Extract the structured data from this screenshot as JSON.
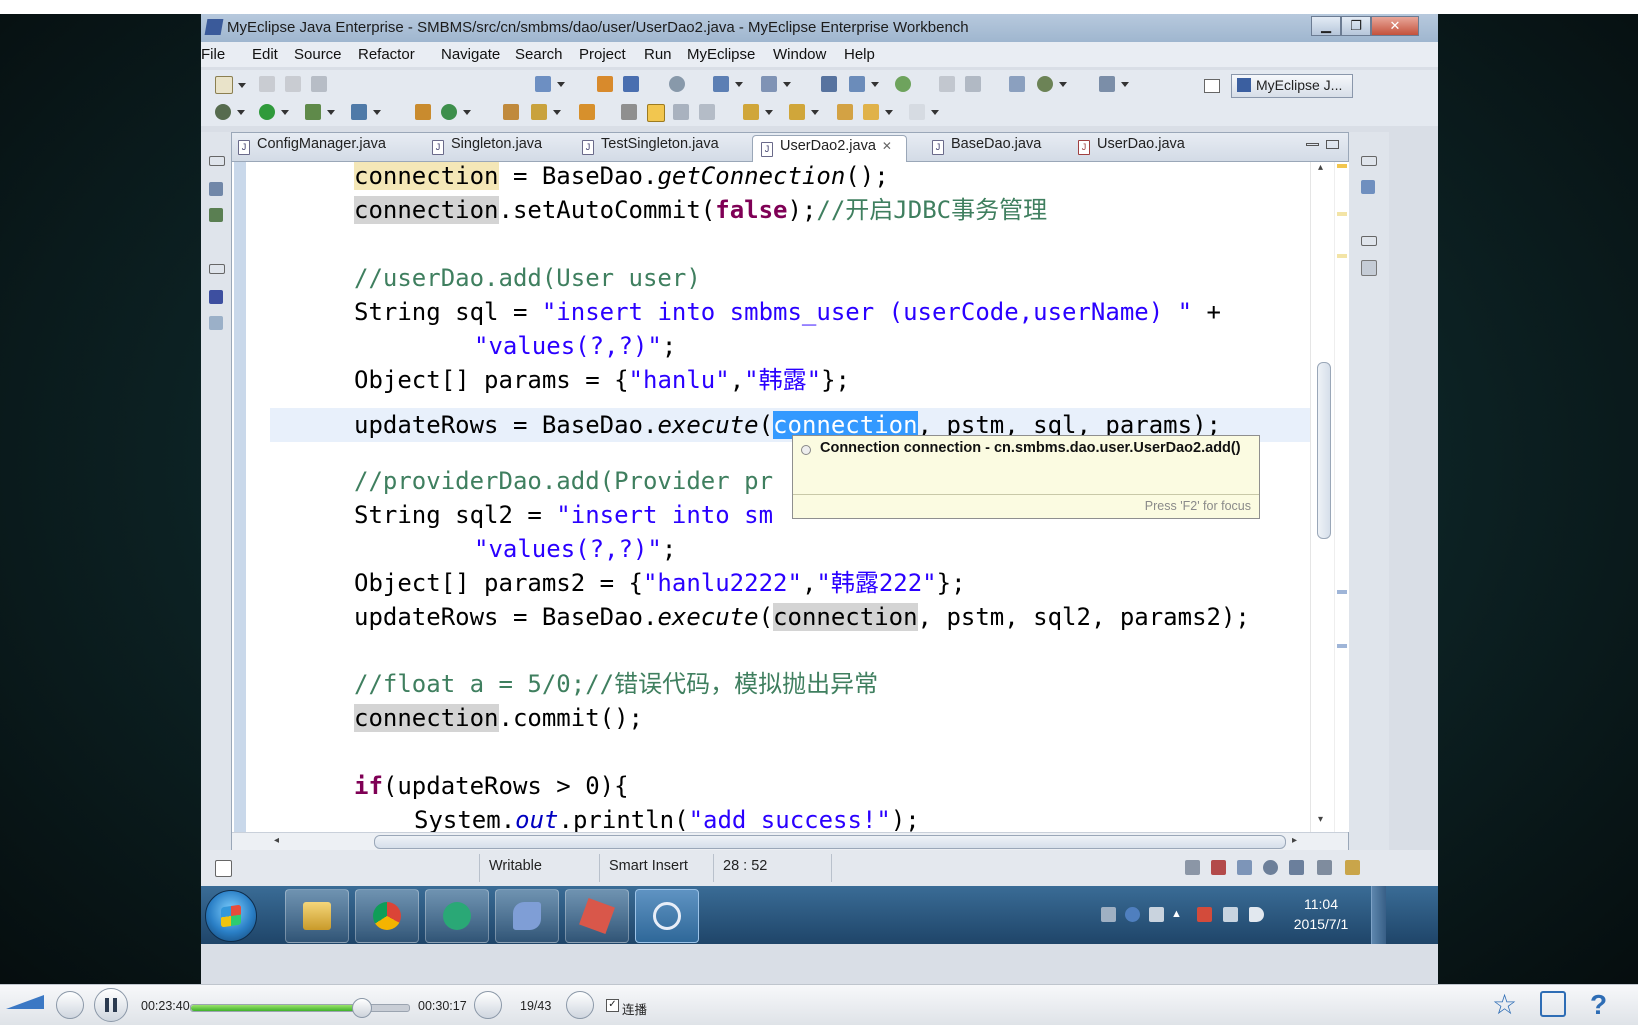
{
  "window": {
    "title": "MyEclipse Java Enterprise - SMBMS/src/cn/smbms/dao/user/UserDao2.java - MyEclipse Enterprise Workbench",
    "minimize": "▁",
    "maximize": "❐",
    "close": "✕"
  },
  "menu": [
    "File",
    "Edit",
    "Source",
    "Refactor",
    "Navigate",
    "Search",
    "Project",
    "Run",
    "MyEclipse",
    "Window",
    "Help"
  ],
  "perspective": {
    "label": "MyEclipse J..."
  },
  "tabs": [
    {
      "label": "ConfigManager.java"
    },
    {
      "label": "Singleton.java"
    },
    {
      "label": "TestSingleton.java"
    },
    {
      "label": "UserDao2.java",
      "active": true
    },
    {
      "label": "BaseDao.java"
    },
    {
      "label": "UserDao.java"
    }
  ],
  "code": {
    "l1": {
      "a": "connection",
      "b": " = BaseDao.",
      "c": "getConnection",
      "d": "();"
    },
    "l2": {
      "a": "connection",
      "b": ".setAutoCommit(",
      "c": "false",
      "d": ");",
      "e": "//开启JDBC事务管理"
    },
    "l4": "//userDao.add(User user)",
    "l5": {
      "a": "String sql = ",
      "b": "\"insert into smbms_user (userCode,userName) \"",
      "c": " +"
    },
    "l6": {
      "a": "\"values(?,?)\"",
      "b": ";"
    },
    "l7": {
      "a": "Object[] params = {",
      "b": "\"hanlu\"",
      "c": ",",
      "d": "\"韩露\"",
      "e": "};"
    },
    "l8": {
      "a": "updateRows = BaseDao.",
      "b": "execute",
      "c": "(",
      "d": "connection",
      "e": ", pstm, sql, params);"
    },
    "l10": "//providerDao.add(Provider pr",
    "l11": {
      "a": "String sql2 = ",
      "b": "\"insert into sm",
      "c": " +"
    },
    "l12": {
      "a": "\"values(?,?)\"",
      "b": ";"
    },
    "l13": {
      "a": "Object[] params2 = {",
      "b": "\"hanlu2222\"",
      "c": ",",
      "d": "\"韩露222\"",
      "e": "};"
    },
    "l14": {
      "a": "updateRows = BaseDao.",
      "b": "execute",
      "c": "(",
      "d": "connection",
      "e": ", pstm, sql2, params2);"
    },
    "l16": "//float a = 5/0;//错误代码，模拟抛出异常",
    "l17": {
      "a": "connection",
      "b": ".commit();"
    },
    "l19": {
      "a": "if",
      "b": "(updateRows > 0){"
    },
    "l20": {
      "a": "System.",
      "b": "out",
      "c": ".println(",
      "d": "\"add success!\"",
      "e": ");"
    }
  },
  "hover": {
    "text": "Connection connection - cn.smbms.dao.user.UserDao2.add()",
    "footer": "Press 'F2' for focus"
  },
  "status": {
    "writable": "Writable",
    "insert": "Smart Insert",
    "position": "28 : 52"
  },
  "taskbar": {
    "time": "11:04",
    "date": "2015/7/1"
  },
  "player": {
    "elapsed": "00:23:40",
    "total": "00:30:17",
    "progress": 0.78,
    "slide": "19/43",
    "continuous_label": "连播",
    "continuous_checked": true
  }
}
